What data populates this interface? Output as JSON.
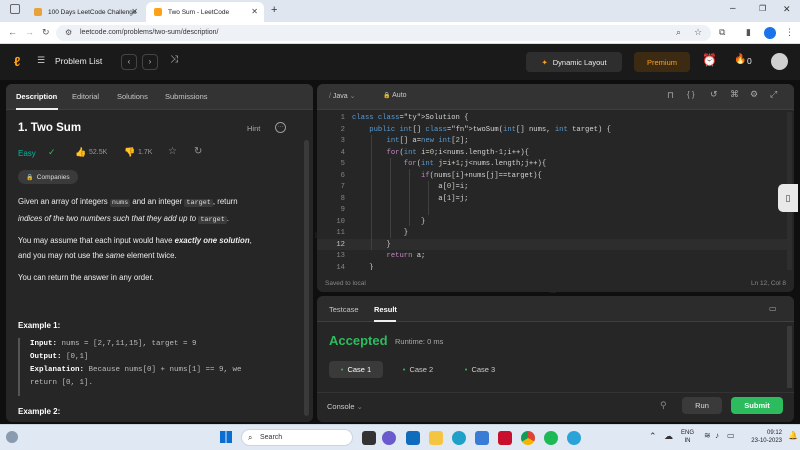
{
  "browser": {
    "tabs": [
      {
        "title": "100 Days LeetCode Challenge",
        "active": false
      },
      {
        "title": "Two Sum - LeetCode",
        "active": true
      }
    ],
    "new_tab": "+",
    "url": "leetcode.com/problems/two-sum/description/"
  },
  "nav": {
    "problem_list": "Problem List",
    "dynamic_layout": "Dynamic Layout",
    "premium": "Premium",
    "streak_count": "0"
  },
  "desc_tabs": [
    "Description",
    "Editorial",
    "Solutions",
    "Submissions"
  ],
  "problem": {
    "title": "1. Two Sum",
    "hint": "Hint",
    "difficulty": "Easy",
    "likes": "52.5K",
    "dislikes": "1.7K",
    "companies": "Companies",
    "para1_a": "Given an array of integers ",
    "para1_code1": "nums",
    "para1_b": " and an integer ",
    "para1_code2": "target",
    "para1_c": ", return",
    "para1_d": "indices of the two numbers such that they add up to ",
    "para1_code3": "target",
    "para1_e": ".",
    "para2_a": "You may assume that each input would have ",
    "para2_b": "exactly one solution",
    "para2_c": ",",
    "para2_d": "and you may not use the ",
    "para2_e": "same",
    "para2_f": " element twice.",
    "para3": "You can return the answer in any order.",
    "example1_title": "Example 1:",
    "ex_input_label": "Input:",
    "ex_input_value": " nums = [2,7,11,15], target = 9",
    "ex_output_label": "Output:",
    "ex_output_value": " [0,1]",
    "ex_expl_label": "Explanation:",
    "ex_expl_value1": " Because nums[0] + nums[1] == 9, we",
    "ex_expl_value2": "return [0, 1].",
    "example2_title": "Example 2:"
  },
  "editor": {
    "language": "Java",
    "mode": "Auto",
    "saved": "Saved to local",
    "position": "Ln 12, Col 8",
    "lines": [
      {
        "n": "1",
        "code": "class Solution {"
      },
      {
        "n": "2",
        "code": "    public int[] twoSum(int[] nums, int target) {"
      },
      {
        "n": "3",
        "code": "        int[] a=new int[2];"
      },
      {
        "n": "4",
        "code": "        for(int i=0;i<nums.length-1;i++){"
      },
      {
        "n": "5",
        "code": "            for(int j=i+1;j<nums.length;j++){"
      },
      {
        "n": "6",
        "code": "                if(nums[i]+nums[j]==target){"
      },
      {
        "n": "7",
        "code": "                    a[0]=i;"
      },
      {
        "n": "8",
        "code": "                    a[1]=j;"
      },
      {
        "n": "9",
        "code": ""
      },
      {
        "n": "10",
        "code": "                }"
      },
      {
        "n": "11",
        "code": "            }"
      },
      {
        "n": "12",
        "code": "        }"
      },
      {
        "n": "13",
        "code": "        return a;"
      },
      {
        "n": "14",
        "code": "    }"
      }
    ]
  },
  "result": {
    "tabs": [
      "Testcase",
      "Result"
    ],
    "status": "Accepted",
    "runtime": "Runtime: 0 ms",
    "cases": [
      "Case 1",
      "Case 2",
      "Case 3"
    ],
    "console": "Console",
    "run": "Run",
    "submit": "Submit"
  },
  "taskbar": {
    "search": "Search",
    "lang_top": "ENG",
    "lang_bottom": "IN",
    "time": "09:12",
    "date": "23-10-2023"
  },
  "colors": {
    "accent_orange": "#ffa116",
    "easy_green": "#00b8a3",
    "accepted_green": "#2cbb5d",
    "submit_green": "#2cbb5d"
  }
}
